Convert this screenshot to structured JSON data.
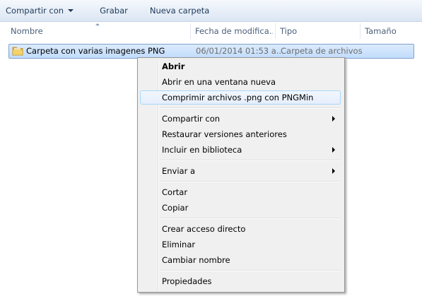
{
  "toolbar": {
    "share_label": "Compartir con",
    "burn_label": "Grabar",
    "new_folder_label": "Nueva carpeta"
  },
  "columns": {
    "name": "Nombre",
    "date": "Fecha de modifica...",
    "type": "Tipo",
    "size": "Tamaño"
  },
  "file": {
    "name": "Carpeta con varias imagenes PNG",
    "date": "06/01/2014 01:53 a...",
    "type": "Carpeta de archivos"
  },
  "context_menu": {
    "items": [
      "Abrir",
      "Abrir en una ventana nueva",
      "Comprimir archivos .png con PNGMin",
      "Compartir con",
      "Restaurar versiones anteriores",
      "Incluir en biblioteca",
      "Enviar a",
      "Cortar",
      "Copiar",
      "Crear acceso directo",
      "Eliminar",
      "Cambiar nombre",
      "Propiedades"
    ]
  },
  "colors": {
    "toolbar_text": "#1e395b",
    "selection_bg": "#cce8ff",
    "menu_bg": "#f0f0f0",
    "menu_highlight_border": "#a8d8fb"
  }
}
